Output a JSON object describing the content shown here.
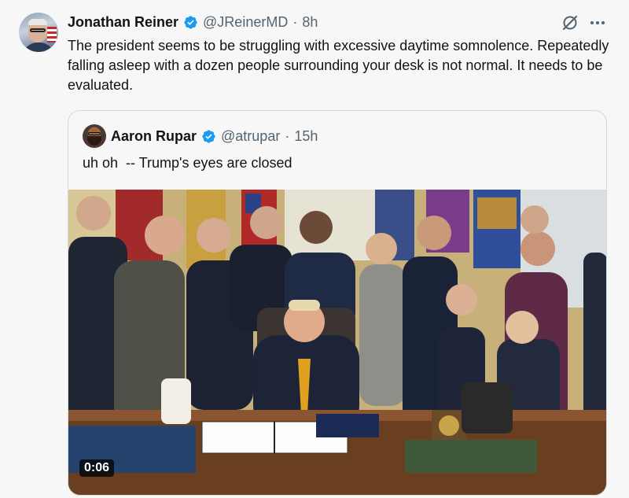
{
  "tweet": {
    "author_name": "Jonathan Reiner",
    "author_handle": "@JReinerMD",
    "separator": "·",
    "time": "8h",
    "text": "The president seems to be struggling with excessive daytime somnolence. Repeatedly falling asleep with a dozen people surrounding your desk is not normal. It needs to be evaluated.",
    "verified_color": "#1d9bf0"
  },
  "quote": {
    "author_name": "Aaron Rupar",
    "author_handle": "@atrupar",
    "separator": "·",
    "time": "15h",
    "text": "uh oh  -- Trump's eyes are closed",
    "video": {
      "duration": "0:06"
    }
  },
  "icons": {
    "verified": "verified-badge-icon",
    "grok": "grok-icon",
    "more": "more-icon"
  }
}
